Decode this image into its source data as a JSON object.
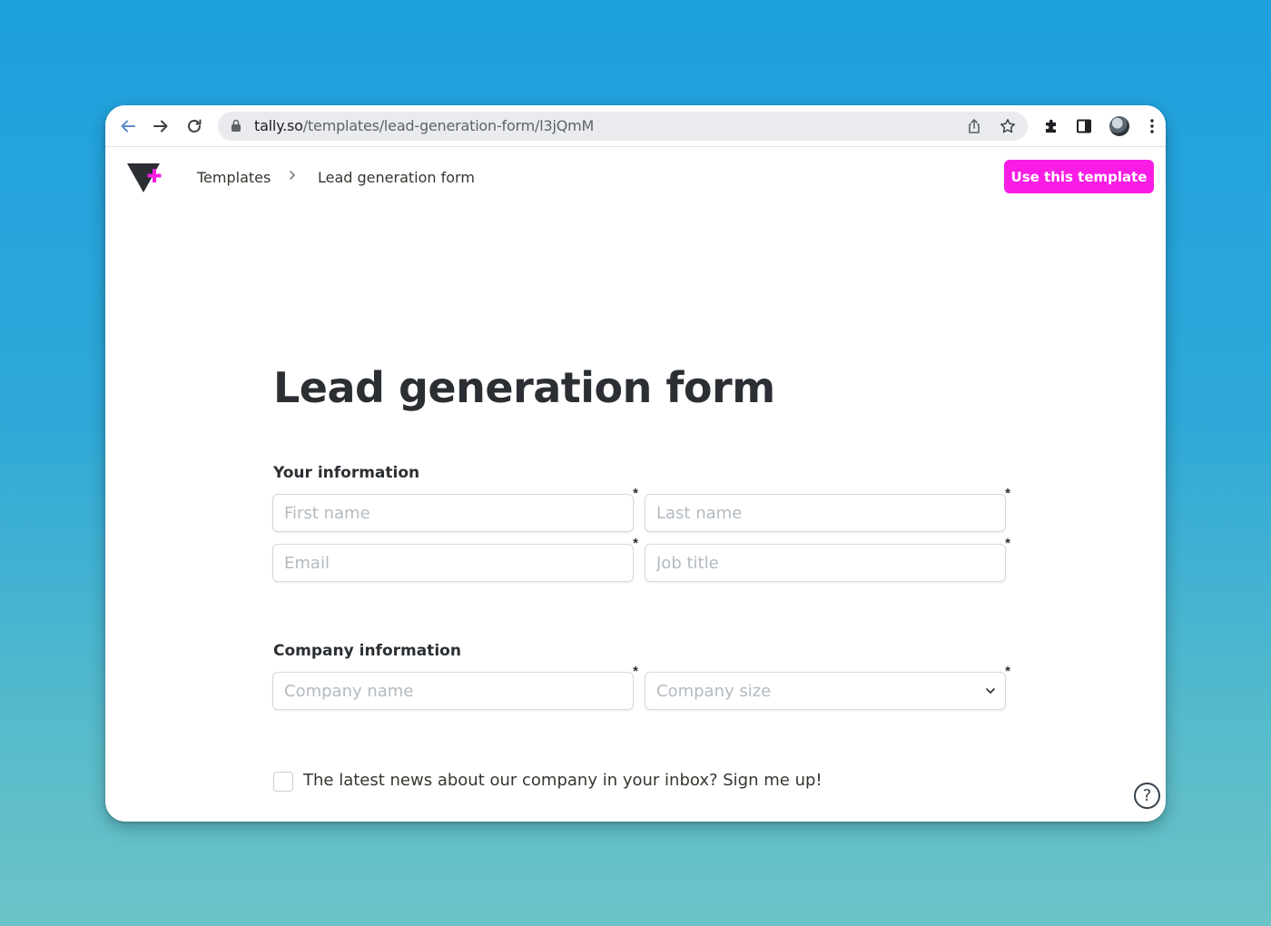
{
  "browser": {
    "url_host": "tally.so",
    "url_path": "/templates/lead-generation-form/l3jQmM"
  },
  "nav": {
    "breadcrumb_root": "Templates",
    "breadcrumb_current": "Lead generation form",
    "cta_label": "Use this template"
  },
  "form": {
    "title": "Lead generation form",
    "section_personal": "Your information",
    "section_company": "Company information",
    "required_marker": "*",
    "fields": {
      "first_name": "First name",
      "last_name": "Last name",
      "email": "Email",
      "job_title": "Job title",
      "company_name": "Company name",
      "company_size": "Company size"
    },
    "newsletter_label": "The latest news about our company in your inbox? Sign me up!"
  },
  "help": {
    "label": "?"
  },
  "colors": {
    "accent": "#f81ce5",
    "text": "#2b2f33",
    "placeholder": "#b3bac0"
  }
}
